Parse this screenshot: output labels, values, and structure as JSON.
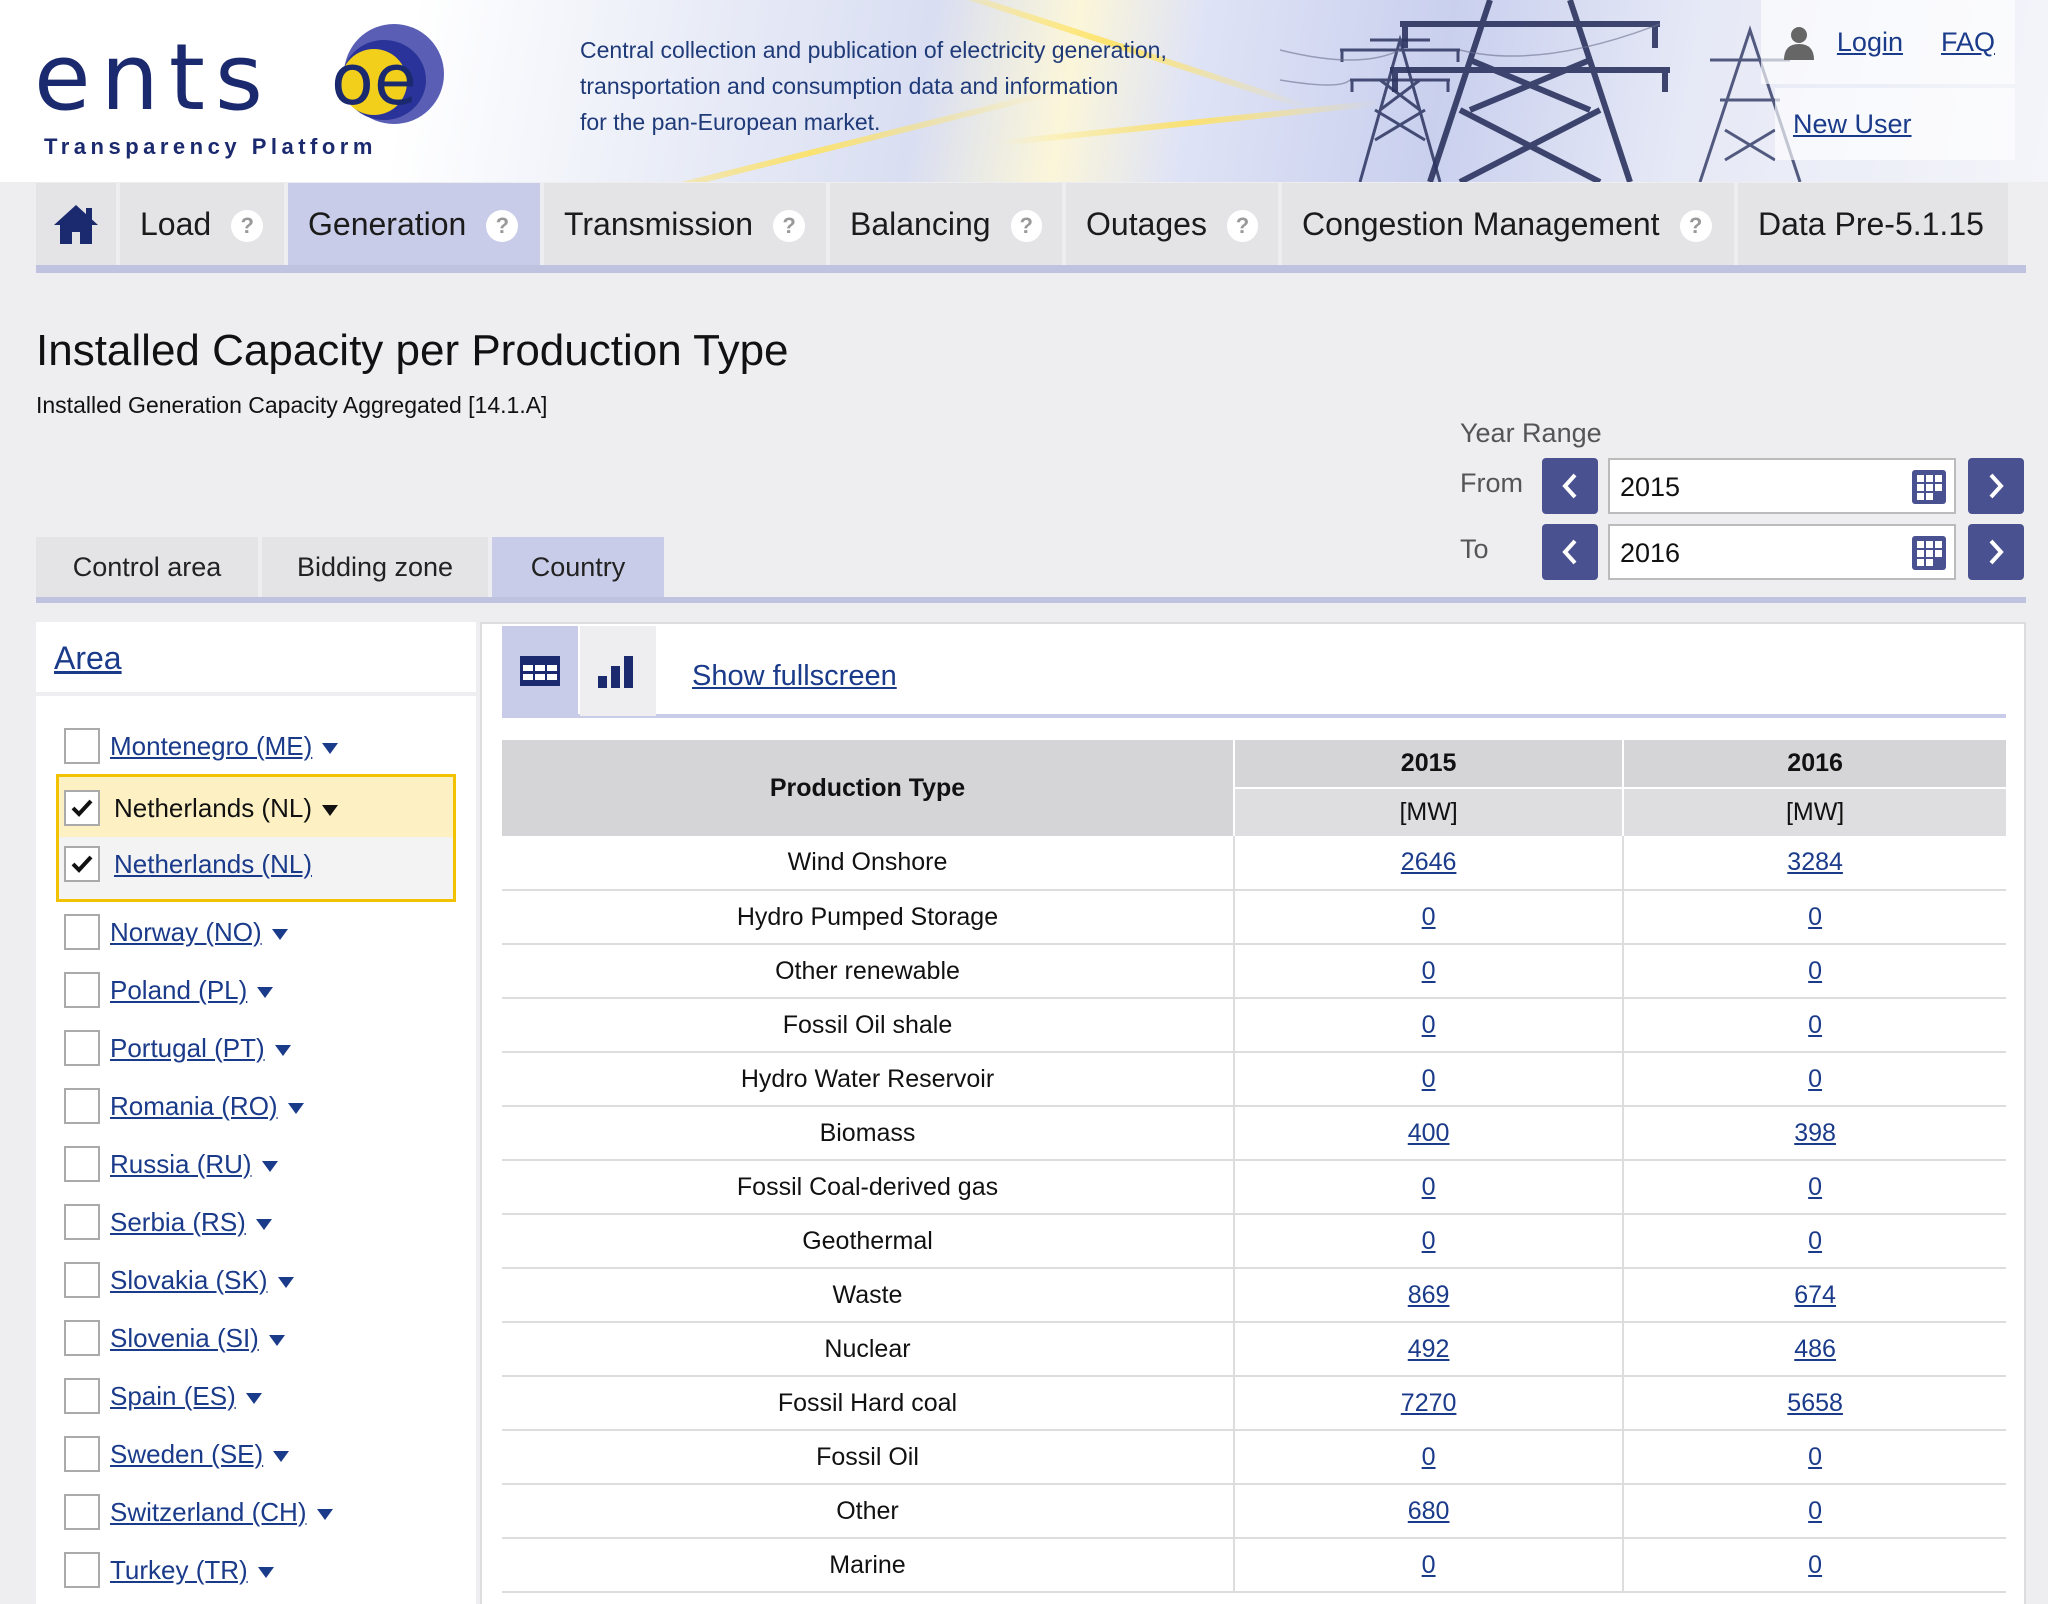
{
  "header": {
    "logo_text": "ents",
    "logo_e": "oe",
    "logo_tag": "Transparency Platform",
    "tagline": [
      "Central collection and publication of electricity generation,",
      "transportation and consumption data and information",
      "for the pan-European market."
    ],
    "login": "Login",
    "faq": "FAQ",
    "new_user": "New User"
  },
  "nav": {
    "items": [
      {
        "label": "Load",
        "help": "?"
      },
      {
        "label": "Generation",
        "help": "?"
      },
      {
        "label": "Transmission",
        "help": "?"
      },
      {
        "label": "Balancing",
        "help": "?"
      },
      {
        "label": "Outages",
        "help": "?"
      },
      {
        "label": "Congestion Management",
        "help": "?"
      },
      {
        "label": "Data Pre-5.1.15"
      }
    ],
    "active": "Generation"
  },
  "page": {
    "title": "Installed Capacity per Production Type",
    "subtitle": "Installed Generation Capacity Aggregated [14.1.A]"
  },
  "year_range": {
    "label": "Year Range",
    "from_label": "From",
    "from_value": "2015",
    "to_label": "To",
    "to_value": "2016"
  },
  "area_tabs": {
    "items": [
      "Control area",
      "Bidding zone",
      "Country"
    ],
    "active": "Country"
  },
  "area": {
    "title": "Area",
    "countries": [
      {
        "label": "Montenegro (ME)",
        "checked": false
      },
      {
        "label": "Netherlands (NL)",
        "checked": true
      },
      {
        "label": "Netherlands (NL)",
        "checked": true
      },
      {
        "label": "Norway (NO)",
        "checked": false
      },
      {
        "label": "Poland (PL)",
        "checked": false
      },
      {
        "label": "Portugal (PT)",
        "checked": false
      },
      {
        "label": "Romania (RO)",
        "checked": false
      },
      {
        "label": "Russia (RU)",
        "checked": false
      },
      {
        "label": "Serbia (RS)",
        "checked": false
      },
      {
        "label": "Slovakia (SK)",
        "checked": false
      },
      {
        "label": "Slovenia (SI)",
        "checked": false
      },
      {
        "label": "Spain (ES)",
        "checked": false
      },
      {
        "label": "Sweden (SE)",
        "checked": false
      },
      {
        "label": "Switzerland (CH)",
        "checked": false
      },
      {
        "label": "Turkey (TR)",
        "checked": false
      }
    ]
  },
  "view": {
    "table_icon": "table-icon",
    "chart_icon": "bar-chart-icon",
    "fullscreen": "Show fullscreen"
  },
  "table": {
    "header": {
      "production_type": "Production Type",
      "years": [
        "2015",
        "2016"
      ],
      "unit": "[MW]"
    },
    "rows": [
      {
        "type": "Wind Onshore",
        "y2015": "2646",
        "y2016": "3284"
      },
      {
        "type": "Hydro Pumped Storage",
        "y2015": "0",
        "y2016": "0"
      },
      {
        "type": "Other renewable",
        "y2015": "0",
        "y2016": "0"
      },
      {
        "type": "Fossil Oil shale",
        "y2015": "0",
        "y2016": "0"
      },
      {
        "type": "Hydro Water Reservoir",
        "y2015": "0",
        "y2016": "0"
      },
      {
        "type": "Biomass",
        "y2015": "400",
        "y2016": "398"
      },
      {
        "type": "Fossil Coal-derived gas",
        "y2015": "0",
        "y2016": "0"
      },
      {
        "type": "Geothermal",
        "y2015": "0",
        "y2016": "0"
      },
      {
        "type": "Waste",
        "y2015": "869",
        "y2016": "674"
      },
      {
        "type": "Nuclear",
        "y2015": "492",
        "y2016": "486"
      },
      {
        "type": "Fossil Hard coal",
        "y2015": "7270",
        "y2016": "5658"
      },
      {
        "type": "Fossil Oil",
        "y2015": "0",
        "y2016": "0"
      },
      {
        "type": "Other",
        "y2015": "680",
        "y2016": "0"
      },
      {
        "type": "Marine",
        "y2015": "0",
        "y2016": "0"
      }
    ]
  },
  "colors": {
    "brand_navy": "#1b2a6e",
    "nav_active": "#c9cce8",
    "button": "#4a5191",
    "highlight_border": "#f2c200",
    "highlight_fill": "#fdf1c4"
  }
}
